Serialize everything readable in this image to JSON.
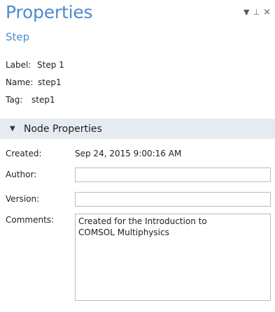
{
  "panel": {
    "title": "Properties",
    "subtitle": "Step",
    "controls": {
      "dropdown_icon": "▼",
      "pin_icon": "⊥",
      "close_icon": "×"
    }
  },
  "info": {
    "label_key": "Label:",
    "label_value": "Step 1",
    "name_key": "Name:",
    "name_value": "step1",
    "tag_key": "Tag:",
    "tag_value": "step1"
  },
  "section": {
    "expander_icon": "▼",
    "title": "Node Properties"
  },
  "node_properties": {
    "created_label": "Created:",
    "created_value": "Sep 24, 2015 9:00:16 AM",
    "author_label": "Author:",
    "author_value": "",
    "version_label": "Version:",
    "version_value": "",
    "comments_label": "Comments:",
    "comments_value": "Created for the Introduction to\nCOMSOL Multiphysics"
  },
  "colors": {
    "accent": "#4b8cd0",
    "section_header_bg": "#e6ebf1",
    "input_border": "#b6bcc6"
  }
}
